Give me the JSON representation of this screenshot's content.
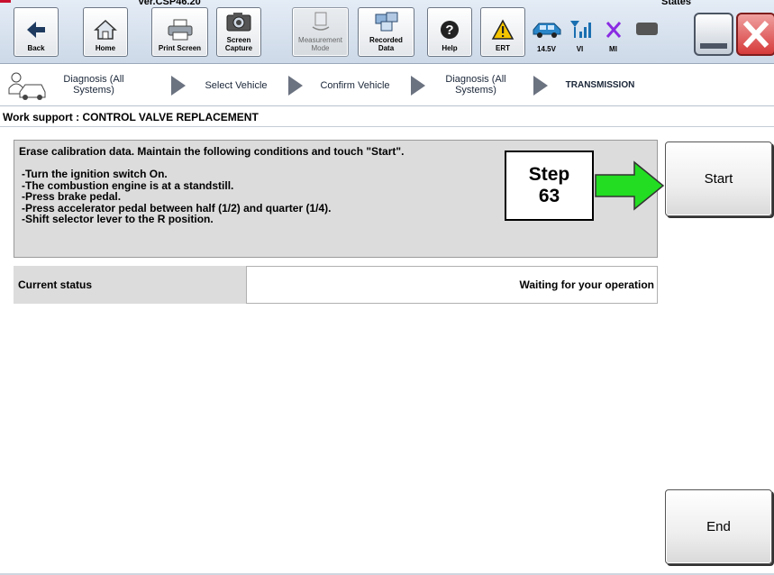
{
  "app": {
    "version": "Ver.CSP46.20",
    "states_label": "States"
  },
  "toolbar": {
    "buttons": [
      {
        "label": "Back",
        "icon": "back-arrow-icon"
      },
      {
        "label": "Home",
        "icon": "home-icon"
      },
      {
        "label": "Print Screen",
        "icon": "printer-icon"
      },
      {
        "label": "Screen\nCapture",
        "icon": "camera-icon"
      },
      {
        "label": "Measurement\nMode",
        "icon": "measurement-icon",
        "disabled": true
      },
      {
        "label": "Recorded\nData",
        "icon": "recorded-data-icon"
      },
      {
        "label": "Help",
        "icon": "help-icon"
      },
      {
        "label": "ERT",
        "icon": "warning-icon"
      }
    ],
    "status": {
      "voltage": "14.5V",
      "vi": "VI",
      "mi": "MI"
    }
  },
  "breadcrumb": [
    "Diagnosis (All\nSystems)",
    "Select Vehicle",
    "Confirm Vehicle",
    "Diagnosis (All\nSystems)",
    "TRANSMISSION"
  ],
  "page": {
    "title": "Work support : CONTROL VALVE REPLACEMENT"
  },
  "instructions": {
    "lead": "Erase calibration data. Maintain the following conditions and touch \"Start\".",
    "lines": [
      "-Turn the ignition switch On.",
      "-The combustion engine is at a standstill.",
      "-Press brake pedal.",
      "-Press accelerator pedal between half (1/2) and quarter (1/4).",
      "-Shift selector lever to the R position."
    ]
  },
  "callout": {
    "step_word": "Step",
    "step_number": "63",
    "arrow_color": "#22dd22"
  },
  "buttons": {
    "start": "Start",
    "end": "End"
  },
  "status": {
    "label": "Current status",
    "value": "Waiting for your operation"
  },
  "colors": {
    "close_button": "#d63a3a",
    "panel_bg": "#dcdcdc",
    "toolbar_bg": "#d5dfec"
  }
}
